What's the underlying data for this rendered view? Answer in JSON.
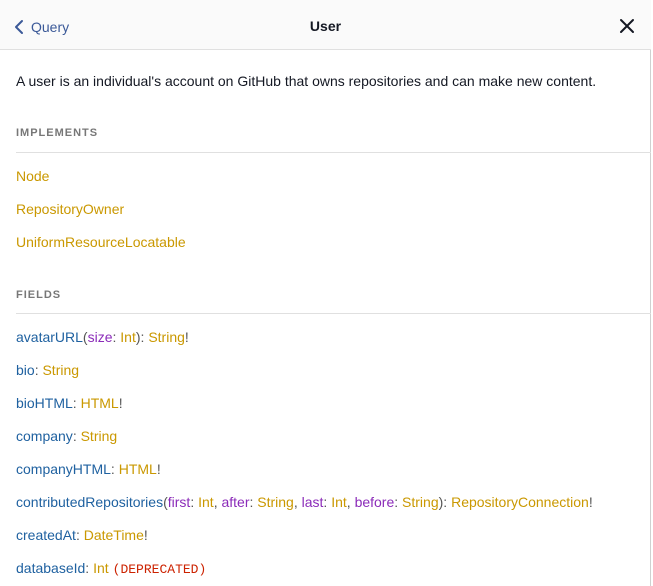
{
  "header": {
    "back_label": "Query",
    "title": "User"
  },
  "description": "A user is an individual's account on GitHub that owns repositories and can make new content.",
  "implements": {
    "heading": "IMPLEMENTS",
    "items": [
      "Node",
      "RepositoryOwner",
      "UniformResourceLocatable"
    ]
  },
  "fields": {
    "heading": "FIELDS",
    "avatarURL": {
      "name": "avatarURL",
      "arg": "size",
      "arg_type": "Int",
      "type": "String",
      "bang": "!"
    },
    "bio": {
      "name": "bio",
      "type": "String"
    },
    "bioHTML": {
      "name": "bioHTML",
      "type": "HTML",
      "bang": "!"
    },
    "company": {
      "name": "company",
      "type": "String"
    },
    "companyHTML": {
      "name": "companyHTML",
      "type": "HTML",
      "bang": "!"
    },
    "contributedRepositories": {
      "name": "contributedRepositories",
      "args": [
        {
          "name": "first",
          "type": "Int"
        },
        {
          "name": "after",
          "type": "String"
        },
        {
          "name": "last",
          "type": "Int"
        },
        {
          "name": "before",
          "type": "String"
        }
      ],
      "type": "RepositoryConnection",
      "bang": "!"
    },
    "createdAt": {
      "name": "createdAt",
      "type": "DateTime",
      "bang": "!"
    },
    "databaseId": {
      "name": "databaseId",
      "type": "Int",
      "deprecated": "(DEPRECATED)"
    }
  },
  "colors": {
    "type": "#ca9800",
    "field_name": "#1f61a0",
    "arg_name": "#8b2bb9",
    "deprecated": "#cc2200",
    "link": "#3b5998"
  },
  "icons": {
    "back": "chevron-left-icon",
    "close": "close-icon"
  }
}
